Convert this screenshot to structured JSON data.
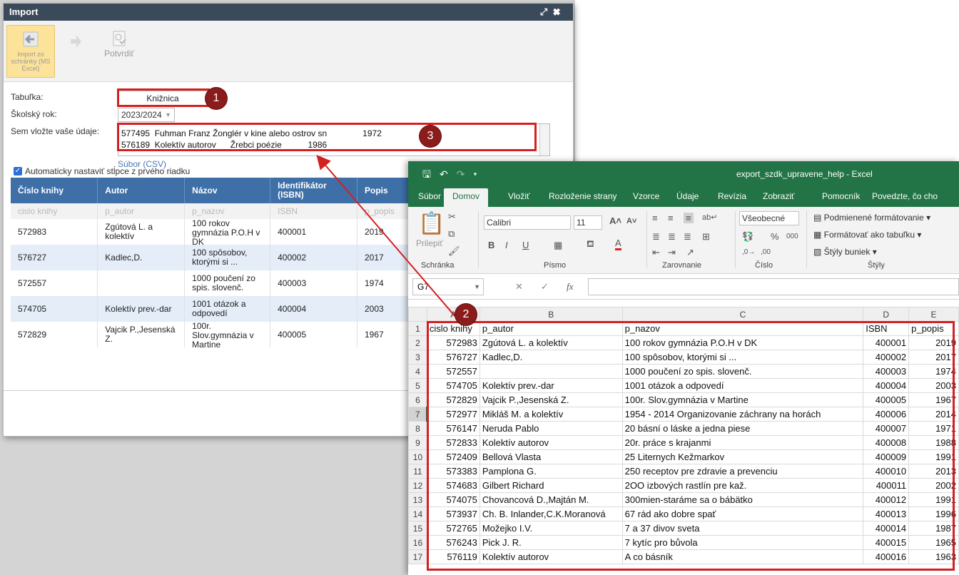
{
  "import_window": {
    "title": "Import",
    "toolbar": {
      "import_clipboard_label": "Import zo schránky (MS Excel)",
      "confirm_label": "Potvrdiť"
    },
    "form": {
      "table_label": "Tabuľka:",
      "table_value": "Knižnica",
      "school_year_label": "Školský rok:",
      "school_year_value": "2023/2024",
      "paste_label": "Sem vložte vaše údaje:",
      "paste_lines": [
        "577495  Fuhman Franz Žonglér v kine alebo ostrov sn               1972",
        "576189  Kolektív autorov      Žrebci poézie           1986"
      ],
      "file_link": "Súbor (CSV)",
      "auto_columns_label": "Automaticky nastaviť stĺpce z prvého riadku"
    },
    "grid": {
      "headers": [
        "Číslo knihy",
        "Autor",
        "Názov",
        "Identifikátor (ISBN)",
        "Popis"
      ],
      "hint_row": [
        "cislo knihy",
        "p_autor",
        "p_nazov",
        "ISBN",
        "p_popis"
      ],
      "rows": [
        [
          "572983",
          "Zgútová L. a kolektív",
          "100 rokov gymnázia P.O.H v DK",
          "400001",
          "2019"
        ],
        [
          "576727",
          "Kadlec,D.",
          "100 spôsobov, ktorými si ...",
          "400002",
          "2017"
        ],
        [
          "572557",
          "",
          "1000 poučení zo spis. slovenč.",
          "400003",
          "1974"
        ],
        [
          "574705",
          "Kolektív prev.-dar",
          "1001 otázok a odpovedí",
          "400004",
          "2003"
        ],
        [
          "572829",
          "Vajcik P.,Jesenská Z.",
          "100r. Slov.gymnázia v Martine",
          "400005",
          "1967"
        ]
      ]
    }
  },
  "badges": [
    "1",
    "2",
    "3"
  ],
  "excel": {
    "title": "export_szdk_upravene_help  -  Excel",
    "tabs": [
      "Súbor",
      "Domov",
      "Vložiť",
      "Rozloženie strany",
      "Vzorce",
      "Údaje",
      "Revízia",
      "Zobraziť",
      "Pomocník",
      "Povedzte, čo cho"
    ],
    "active_tab": "Domov",
    "ribbon": {
      "clipboard_group": "Schránka",
      "paste_label": "Prilepiť",
      "font_group": "Písmo",
      "font_name": "Calibri",
      "font_size": "11",
      "alignment_group": "Zarovnanie",
      "number_group": "Číslo",
      "number_format": "Všeobecné",
      "styles_group": "Štýly",
      "cond_format": "Podmienené formátovanie",
      "format_table": "Formátovať ako tabuľku",
      "cell_styles": "Štýly buniek"
    },
    "name_box": "G7",
    "fx_label": "fx",
    "columns": [
      "A",
      "B",
      "C",
      "D",
      "E"
    ],
    "rows": [
      [
        "1",
        "cislo knihy",
        "p_autor",
        "p_nazov",
        "ISBN",
        "p_popis"
      ],
      [
        "2",
        "572983",
        "Zgútová L. a kolektív",
        "100 rokov gymnázia P.O.H v DK",
        "400001",
        "2019"
      ],
      [
        "3",
        "576727",
        "Kadlec,D.",
        "100 spôsobov, ktorými si ...",
        "400002",
        "2017"
      ],
      [
        "4",
        "572557",
        "",
        "1000 poučení zo spis. slovenč.",
        "400003",
        "1974"
      ],
      [
        "5",
        "574705",
        "Kolektív prev.-dar",
        "1001 otázok a odpovedí",
        "400004",
        "2003"
      ],
      [
        "6",
        "572829",
        "Vajcik P.,Jesenská Z.",
        "100r. Slov.gymnázia v Martine",
        "400005",
        "1967"
      ],
      [
        "7",
        "572977",
        "Mikláš M. a kolektív",
        "1954 - 2014 Organizovanie záchrany na horách",
        "400006",
        "2014"
      ],
      [
        "8",
        "576147",
        "Neruda Pablo",
        "20 básní o láske a jedna piese",
        "400007",
        "1971"
      ],
      [
        "9",
        "572833",
        "Kolektív autorov",
        "20r. práce s krajanmi",
        "400008",
        "1988"
      ],
      [
        "10",
        "572409",
        "Bellová Vlasta",
        "25 Liternych Kežmarkov",
        "400009",
        "1991"
      ],
      [
        "11",
        "573383",
        "Pamplona G.",
        "250 receptov pre zdravie a prevenciu",
        "400010",
        "2013"
      ],
      [
        "12",
        "574683",
        "Gilbert Richard",
        "2OO izbových rastlín pre kaž.",
        "400011",
        "2002"
      ],
      [
        "13",
        "574075",
        "Chovancová D.,Majtán M.",
        "300mien-staráme sa o bábätko",
        "400012",
        "1991"
      ],
      [
        "14",
        "573937",
        "Ch. B. Inlander,C.K.Moranová",
        "67 rád ako dobre spať",
        "400013",
        "1996"
      ],
      [
        "15",
        "572765",
        "Možejko I.V.",
        "7 a 37 divov sveta",
        "400014",
        "1987"
      ],
      [
        "16",
        "576243",
        "Pick J. R.",
        "7 kytíc pro bůvola",
        "400015",
        "1965"
      ],
      [
        "17",
        "576119",
        "Kolektív autorov",
        "A co básník",
        "400016",
        "1963"
      ]
    ]
  },
  "colors": {
    "excel_green": "#227446",
    "grid_header": "#3e6fa7",
    "highlight_red": "#d42020",
    "badge": "#8b1c1c"
  }
}
